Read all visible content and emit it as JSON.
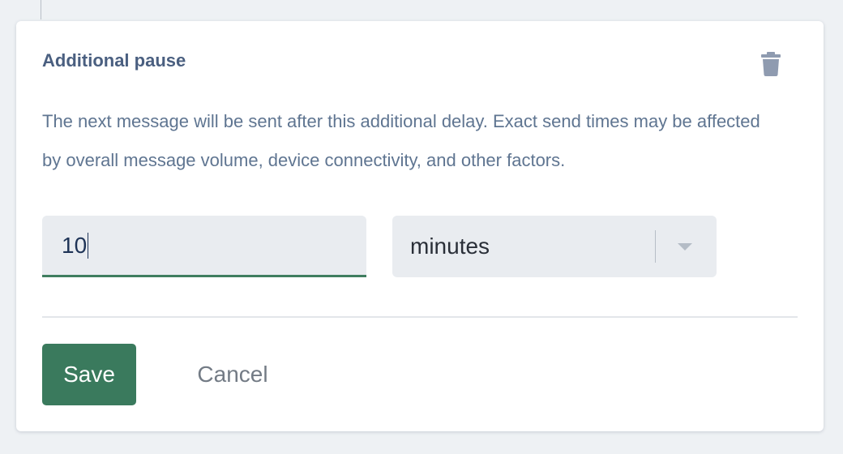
{
  "pause_card": {
    "title": "Additional pause",
    "description": "The next message will be sent after this additional delay. Exact send times may be affected by overall message volume, device connectivity, and other factors.",
    "delay_value": "10",
    "delay_unit": "minutes",
    "save_label": "Save",
    "cancel_label": "Cancel"
  },
  "icons": {
    "delete": "trash-icon",
    "dropdown": "chevron-down-icon"
  },
  "colors": {
    "primary": "#3a7a5d",
    "title": "#4a5f80",
    "description": "#5f7591",
    "field_bg": "#e9ecf0",
    "focus_underline": "#3f7d5f"
  }
}
